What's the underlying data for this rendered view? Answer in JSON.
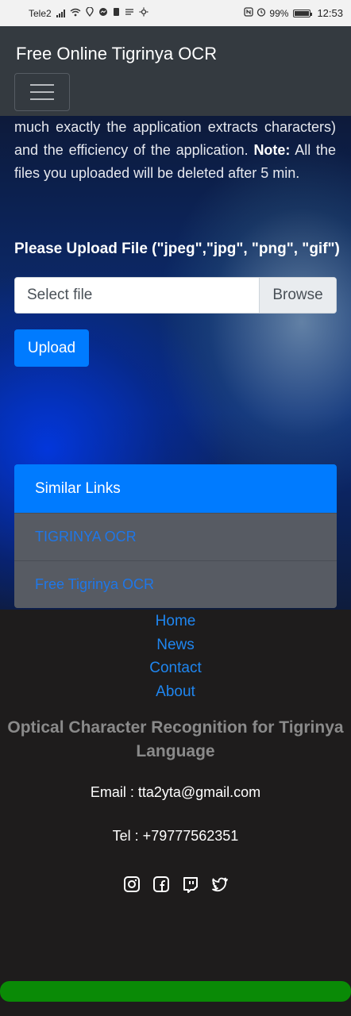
{
  "status_bar": {
    "carrier": "Tele2",
    "battery": "99%",
    "time": "12:53"
  },
  "navbar": {
    "brand": "Free Online Tigrinya OCR",
    "menu_icon": "hamburger-icon"
  },
  "intro": {
    "part1": "much exactly the application extracts characters) and the efficiency of the application. ",
    "note_label": "Note:",
    "part2": " All the files you uploaded will be deleted after 5 min."
  },
  "upload": {
    "label": "Please Upload File (\"jpeg\",\"jpg\", \"png\", \"gif\")",
    "file_placeholder": "Select file",
    "browse_label": "Browse",
    "upload_label": "Upload"
  },
  "similar_links": {
    "title": "Similar Links",
    "items": [
      {
        "label": "TIGRINYA OCR"
      },
      {
        "label": "Free Tigrinya OCR"
      }
    ]
  },
  "footer": {
    "nav": [
      {
        "label": "Home"
      },
      {
        "label": "News"
      },
      {
        "label": "Contact"
      },
      {
        "label": "About"
      }
    ],
    "title": "Optical Character Recognition for Tigrinya Language",
    "email": "Email : tta2yta@gmail.com",
    "tel": "Tel : +79777562351",
    "social_icons": [
      "instagram-icon",
      "facebook-icon",
      "twitch-icon",
      "twitter-icon"
    ]
  },
  "progress": {
    "value": 1.0,
    "color": "#0a8a06"
  }
}
